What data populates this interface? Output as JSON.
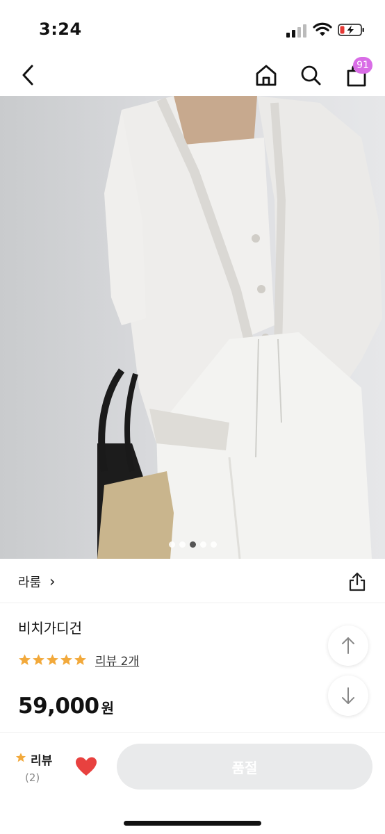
{
  "status_bar": {
    "time": "3:24"
  },
  "nav": {
    "icons": [
      "back-icon",
      "home-icon",
      "search-icon",
      "shopping-bag-icon"
    ],
    "cart_count": "91",
    "badge_color": "#d96de6"
  },
  "image_carousel": {
    "total": 5,
    "active_index": 2
  },
  "product": {
    "brand": "라룸",
    "brand_chevron": "›",
    "title": "비치가디건",
    "rating_stars": 5,
    "star_color": "#f2a93b",
    "review_link": "리뷰 2개",
    "price": "59,000",
    "price_unit": "원"
  },
  "bottom_bar": {
    "review_label": "리뷰",
    "review_count": "(2)",
    "heart_color": "#e8413f",
    "soldout_label": "품절",
    "soldout_bg": "#e9eaeb"
  }
}
